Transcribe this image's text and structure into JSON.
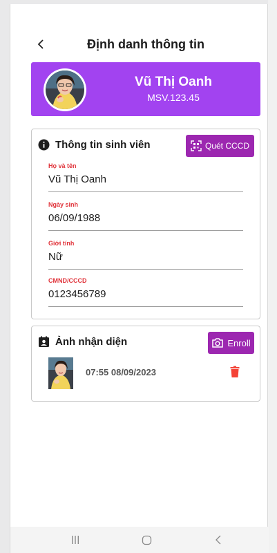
{
  "header": {
    "title": "Định danh thông tin"
  },
  "profile": {
    "name": "Vũ Thị Oanh",
    "code": "MSV.123.45"
  },
  "info_card": {
    "title": "Thông tin sinh viên",
    "scan_label": "Quét CCCD",
    "fields": [
      {
        "label": "Họ và tên",
        "value": "Vũ Thị Oanh"
      },
      {
        "label": "Ngày sinh",
        "value": "06/09/1988"
      },
      {
        "label": "Giới tính",
        "value": "Nữ"
      },
      {
        "label": "CMND/CCCD",
        "value": "0123456789"
      }
    ]
  },
  "photo_card": {
    "title": "Ảnh nhận diện",
    "enroll_label": "Enroll",
    "items": [
      {
        "timestamp": "07:55 08/09/2023"
      }
    ]
  },
  "colors": {
    "accent": "#a243f0",
    "button": "#9c27b0",
    "label_red": "#e0333a",
    "delete_red": "#f44336"
  },
  "icons": {
    "back": "chevron-left-icon",
    "info": "info-icon",
    "scan": "qr-scan-icon",
    "photo_section": "contact-card-icon",
    "enroll": "camera-icon",
    "delete": "trash-icon",
    "nav": [
      "recent-apps-icon",
      "home-icon",
      "back-icon"
    ]
  }
}
